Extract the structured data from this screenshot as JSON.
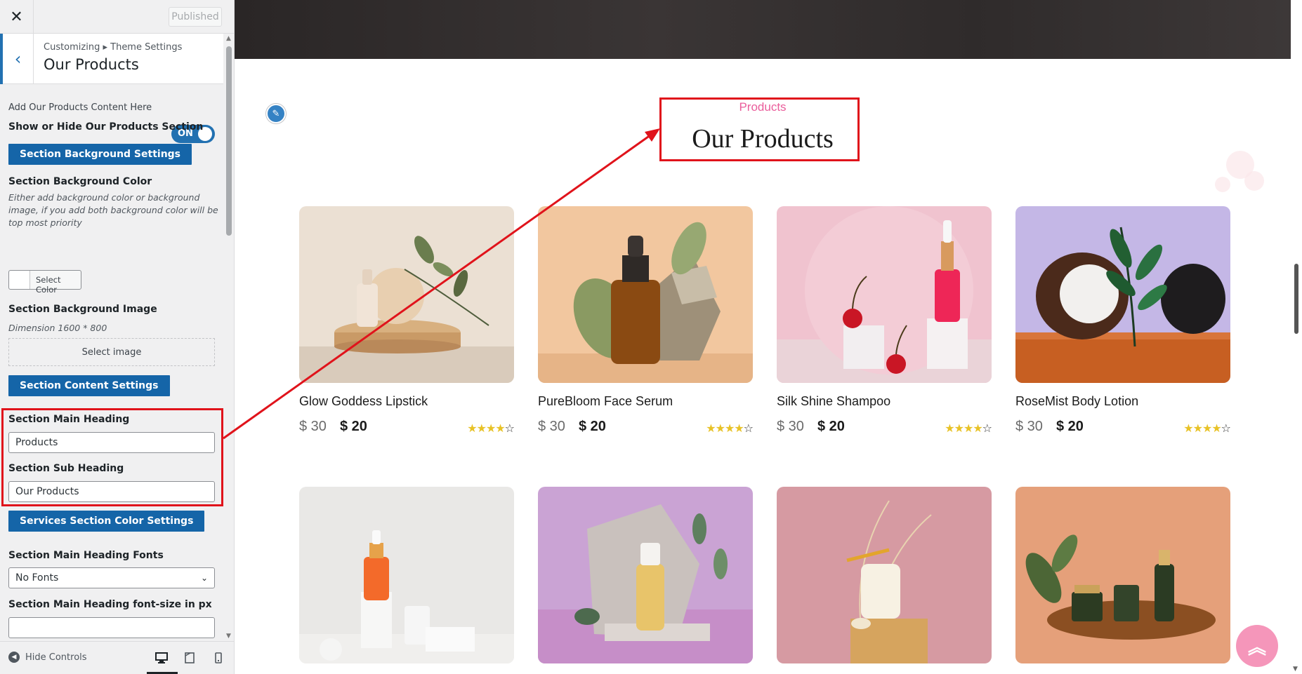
{
  "customizer": {
    "close_icon": "close-icon",
    "published_label": "Published",
    "breadcrumb": "Customizing ▸ Theme Settings",
    "section_title": "Our Products",
    "intro_text": "Add Our Products Content Here",
    "toggle_label": "ON",
    "show_hide_label": "Show or Hide Our Products Section",
    "bg_settings_button": "Section Background Settings",
    "bg_color_label": "Section Background Color",
    "bg_color_desc": "Either add background color or background image, if you add both background color will be top most priority",
    "select_color_label": "Select Color",
    "bg_image_label": "Section Background Image",
    "bg_image_desc": "Dimension 1600 * 800",
    "select_image_label": "Select image",
    "content_settings_button": "Section Content Settings",
    "main_heading_label": "Section Main Heading",
    "main_heading_value": "Products",
    "sub_heading_label": "Section Sub Heading",
    "sub_heading_value": "Our Products",
    "color_settings_button": "Services Section Color Settings",
    "heading_fonts_label": "Section Main Heading Fonts",
    "heading_fonts_value": "No Fonts",
    "heading_size_label": "Section Main Heading font-size in px",
    "heading_size_value": "",
    "hide_controls_label": "Hide Controls"
  },
  "preview": {
    "section_sub": "Products",
    "section_main": "Our Products",
    "products": [
      {
        "name": "Glow Goddess Lipstick",
        "old_price": "$ 30",
        "new_price": "$ 20",
        "rating": 4
      },
      {
        "name": "PureBloom Face Serum",
        "old_price": "$ 30",
        "new_price": "$ 20",
        "rating": 4
      },
      {
        "name": "Silk Shine Shampoo",
        "old_price": "$ 30",
        "new_price": "$ 20",
        "rating": 4
      },
      {
        "name": "RoseMist Body Lotion",
        "old_price": "$ 30",
        "new_price": "$ 20",
        "rating": 4
      }
    ]
  },
  "colors": {
    "accent_blue": "#2271b1",
    "button_blue": "#1565a8",
    "highlight_red": "#e0131b",
    "pink": "#ea5d9b",
    "star_yellow": "#e8c227"
  }
}
